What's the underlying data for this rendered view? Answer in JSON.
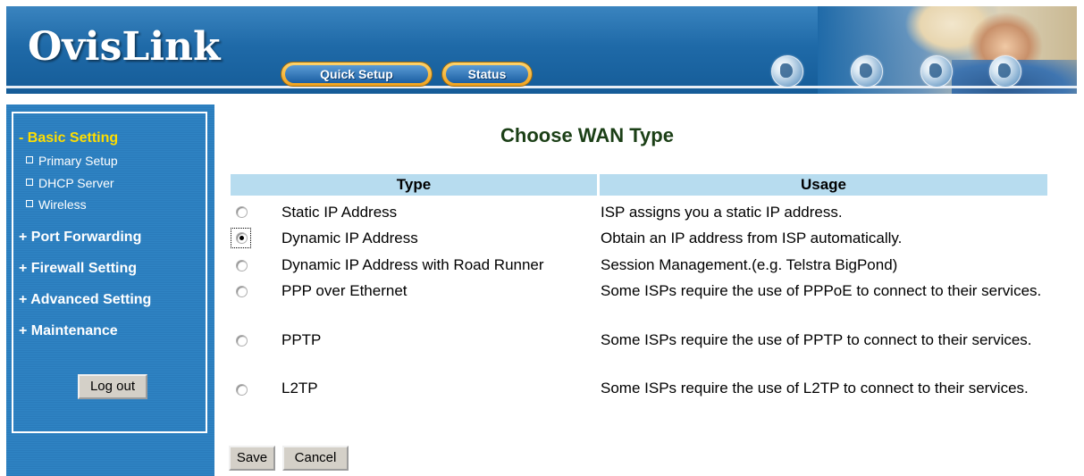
{
  "header": {
    "logo": "OvisLink",
    "nav": [
      {
        "label": "Quick Setup"
      },
      {
        "label": "Status"
      }
    ]
  },
  "sidebar": {
    "sections": [
      {
        "label": "- Basic Setting",
        "active": true,
        "items": [
          {
            "label": "Primary Setup"
          },
          {
            "label": "DHCP Server"
          },
          {
            "label": "Wireless"
          }
        ]
      },
      {
        "label": "+ Port Forwarding"
      },
      {
        "label": "+ Firewall Setting"
      },
      {
        "label": "+ Advanced Setting"
      },
      {
        "label": "+ Maintenance"
      }
    ],
    "logout_label": "Log out"
  },
  "main": {
    "title": "Choose WAN Type",
    "columns": {
      "type": "Type",
      "usage": "Usage"
    },
    "rows": [
      {
        "type": "Static IP Address",
        "usage": "ISP assigns you a static IP address.",
        "checked": false
      },
      {
        "type": "Dynamic IP Address",
        "usage": "Obtain an IP address from ISP automatically.",
        "checked": true
      },
      {
        "type": "Dynamic IP Address with Road Runner",
        "usage": "Session Management.(e.g. Telstra BigPond)",
        "checked": false
      },
      {
        "type": "PPP over Ethernet",
        "usage": "Some ISPs require the use of PPPoE to connect to their services.",
        "checked": false
      },
      {
        "type": "PPTP",
        "usage": "Some ISPs require the use of PPTP to connect to their services.",
        "checked": false
      },
      {
        "type": "L2TP",
        "usage": "Some ISPs require the use of L2TP to connect to their services.",
        "checked": false
      }
    ],
    "save_label": "Save",
    "cancel_label": "Cancel"
  },
  "colors": {
    "header_blue": "#1f6aa8",
    "sidebar_blue": "#2f84c4",
    "active_menu": "#ffde00",
    "title_green": "#1b3f16",
    "table_header": "#b7dcef"
  }
}
